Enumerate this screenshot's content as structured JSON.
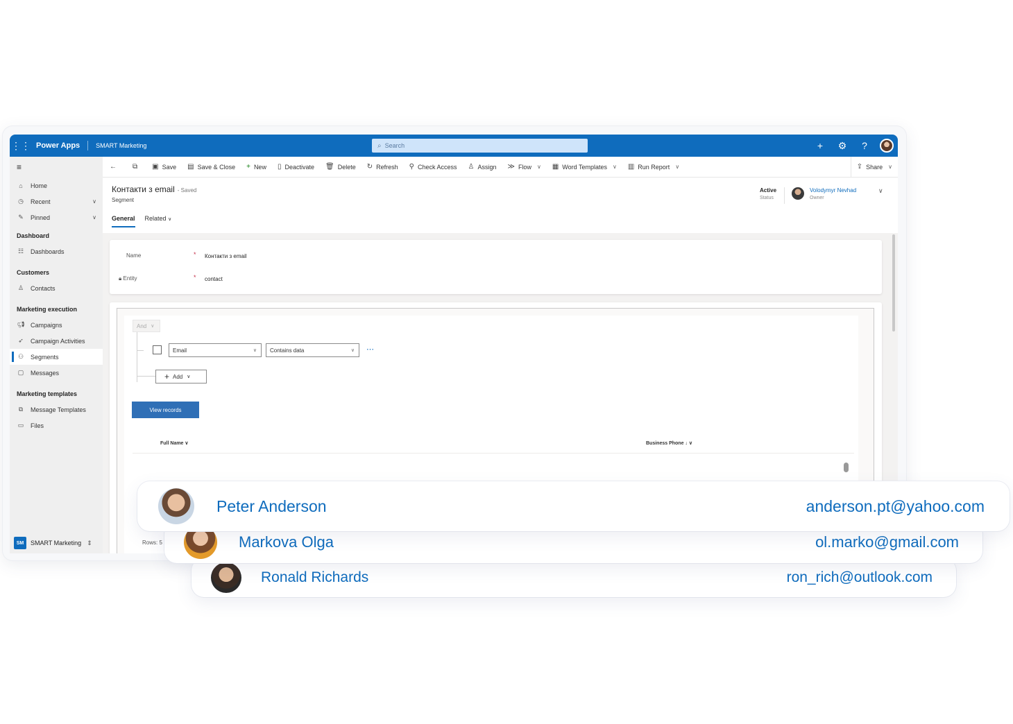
{
  "topbar": {
    "brand": "Power Apps",
    "app_name": "SMART Marketing",
    "search_placeholder": "Search"
  },
  "sidebar": {
    "items_top": [
      {
        "label": "Home",
        "icon": "home-icon"
      },
      {
        "label": "Recent",
        "icon": "clock-icon"
      },
      {
        "label": "Pinned",
        "icon": "pin-icon"
      }
    ],
    "groups": [
      {
        "title": "Dashboard",
        "items": [
          {
            "label": "Dashboards",
            "icon": "dashboard-icon"
          }
        ]
      },
      {
        "title": "Customers",
        "items": [
          {
            "label": "Contacts",
            "icon": "person-icon"
          }
        ]
      },
      {
        "title": "Marketing execution",
        "items": [
          {
            "label": "Campaigns",
            "icon": "megaphone-icon"
          },
          {
            "label": "Campaign Activities",
            "icon": "rocket-icon"
          },
          {
            "label": "Segments",
            "icon": "people-icon"
          },
          {
            "label": "Messages",
            "icon": "message-icon"
          }
        ]
      },
      {
        "title": "Marketing templates",
        "items": [
          {
            "label": "Message Templates",
            "icon": "template-icon"
          },
          {
            "label": "Files",
            "icon": "image-icon"
          }
        ]
      }
    ],
    "footer_badge": "SM",
    "footer_label": "SMART Marketing"
  },
  "commands": {
    "save": "Save",
    "save_close": "Save & Close",
    "new": "New",
    "deactivate": "Deactivate",
    "delete": "Delete",
    "refresh": "Refresh",
    "check_access": "Check Access",
    "assign": "Assign",
    "flow": "Flow",
    "word_templates": "Word Templates",
    "run_report": "Run Report",
    "share": "Share"
  },
  "record": {
    "title": "Контакти з email",
    "saved": "- Saved",
    "entity_type": "Segment",
    "status_value": "Active",
    "status_label": "Status",
    "owner_name": "Volodymyr Nevhad",
    "owner_label": "Owner"
  },
  "tabs": {
    "general": "General",
    "related": "Related"
  },
  "form": {
    "name_label": "Name",
    "name_value": "Контакти з email",
    "entity_label": "Entity",
    "entity_value": "contact"
  },
  "query": {
    "operator": "And",
    "field": "Email",
    "condition": "Contains data",
    "add_label": "Add",
    "view_button": "View records",
    "col_full_name": "Full Name",
    "col_business_phone": "Business Phone",
    "rows_label": "Rows: 5"
  },
  "contacts": [
    {
      "name": "Peter Anderson",
      "email": "anderson.pt@yahoo.com"
    },
    {
      "name": "Markova Olga",
      "email": "ol.marko@gmail.com"
    },
    {
      "name": "Ronald Richards",
      "email": "ron_rich@outlook.com"
    }
  ],
  "colors": {
    "accent": "#0f6cbd",
    "primary_button": "#2f6fb6"
  }
}
